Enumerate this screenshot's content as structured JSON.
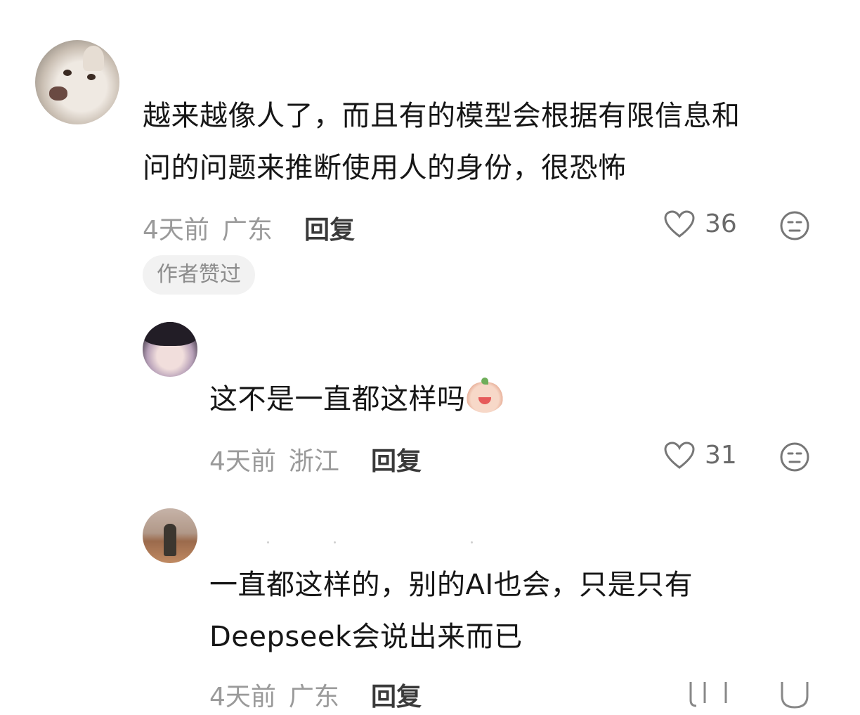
{
  "comments": [
    {
      "text_line1": "越来越像人了，而且有的模型会根据有限信息和",
      "text_line2": "问的问题来推断使用人的身份，很恐怖",
      "time": "4天前",
      "location": "广东",
      "reply_label": "回复",
      "likes": "36",
      "badge": "作者赞过"
    },
    {
      "text": "这不是一直都这样吗",
      "emoji": "crying-laughing-emoji",
      "time": "4天前",
      "location": "浙江",
      "reply_label": "回复",
      "likes": "31"
    },
    {
      "text_line1": "一直都这样的，别的AI也会，只是只有",
      "text_line2": "Deepseek会说出来而已",
      "time": "4天前",
      "location": "广东",
      "reply_label": "回复"
    }
  ]
}
